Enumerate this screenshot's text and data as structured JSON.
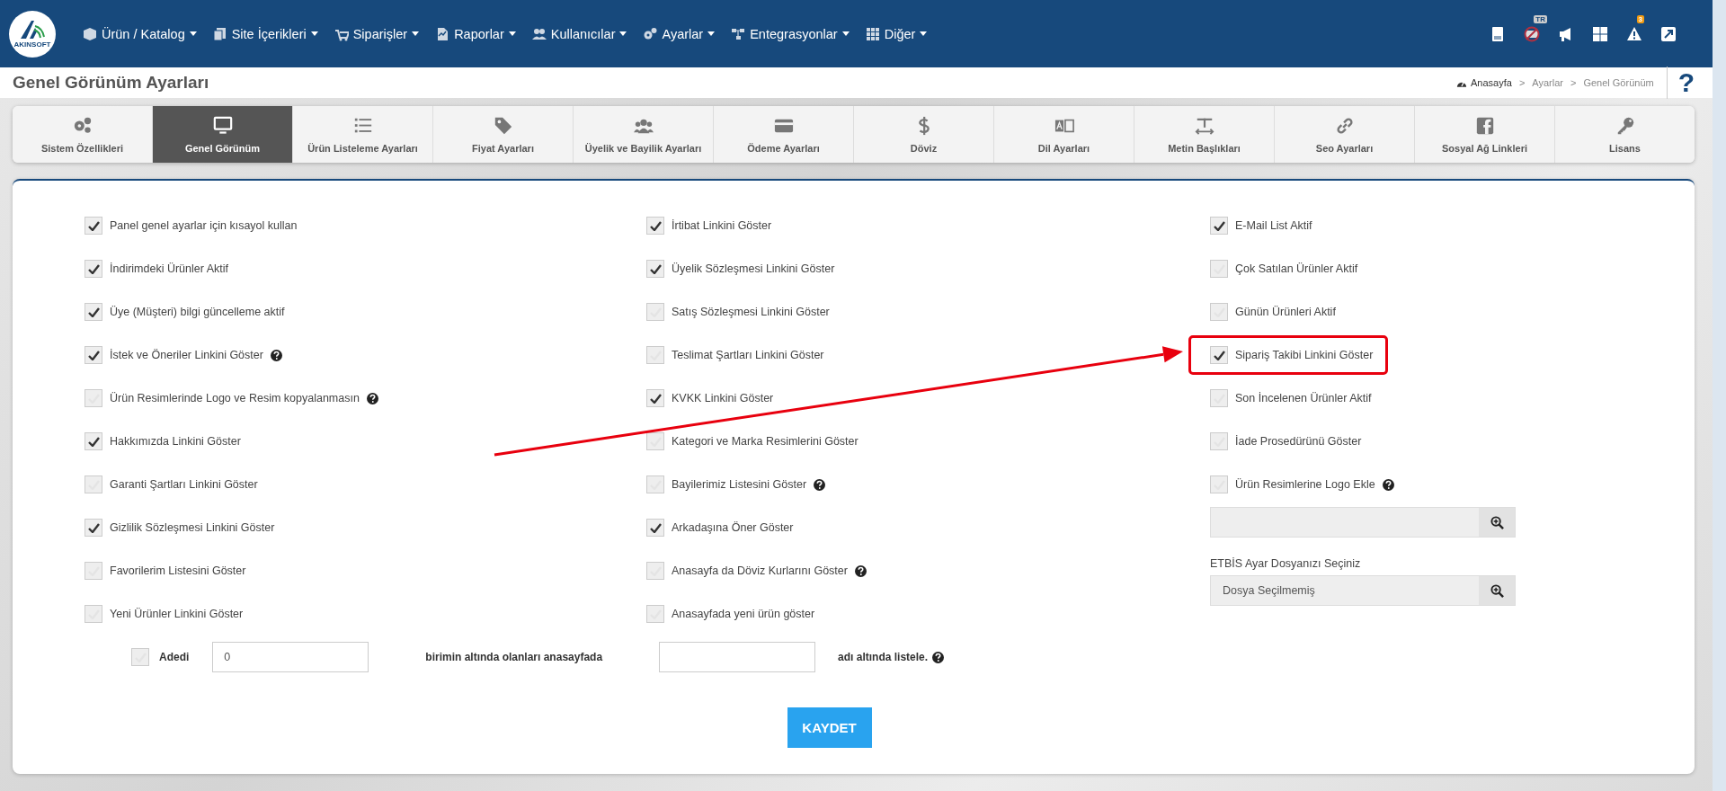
{
  "header": {
    "logo_text": "AKINSOFT",
    "nav": [
      {
        "label": "Ürün / Katalog"
      },
      {
        "label": "Site İçerikleri"
      },
      {
        "label": "Siparişler"
      },
      {
        "label": "Raporlar"
      },
      {
        "label": "Kullanıcılar"
      },
      {
        "label": "Ayarlar"
      },
      {
        "label": "Entegrasyonlar"
      },
      {
        "label": "Diğer"
      }
    ],
    "tools": {
      "language_badge": "TR",
      "alert_count": "3"
    }
  },
  "page_title": "Genel Görünüm Ayarları",
  "breadcrumb": {
    "separator": ">",
    "items": [
      "Anasayfa",
      "Ayarlar",
      "Genel Görünüm"
    ],
    "help": "?"
  },
  "tabs": [
    {
      "label": "Sistem Özellikleri",
      "selected": false
    },
    {
      "label": "Genel Görünüm",
      "selected": true
    },
    {
      "label": "Ürün Listeleme Ayarları",
      "selected": false
    },
    {
      "label": "Fiyat Ayarları",
      "selected": false
    },
    {
      "label": "Üyelik ve Bayilik Ayarları",
      "selected": false
    },
    {
      "label": "Ödeme Ayarları",
      "selected": false
    },
    {
      "label": "Döviz",
      "selected": false
    },
    {
      "label": "Dil Ayarları",
      "selected": false
    },
    {
      "label": "Metin Başlıkları",
      "selected": false
    },
    {
      "label": "Seo Ayarları",
      "selected": false
    },
    {
      "label": "Sosyal Ağ Linkleri",
      "selected": false
    },
    {
      "label": "Lisans",
      "selected": false
    }
  ],
  "columns": [
    {
      "items": [
        {
          "label": "Panel genel ayarlar için kısayol kullan",
          "checked": true,
          "help": false,
          "highlighted": false
        },
        {
          "label": "İndirimdeki Ürünler Aktif",
          "checked": true,
          "help": false,
          "highlighted": false
        },
        {
          "label": "Üye (Müşteri) bilgi güncelleme aktif",
          "checked": true,
          "help": false,
          "highlighted": false
        },
        {
          "label": "İstek ve Öneriler Linkini Göster",
          "checked": true,
          "help": true,
          "highlighted": false
        },
        {
          "label": "Ürün Resimlerinde Logo ve Resim kopyalanmasın",
          "checked": false,
          "help": true,
          "highlighted": false
        },
        {
          "label": "Hakkımızda Linkini Göster",
          "checked": true,
          "help": false,
          "highlighted": false
        },
        {
          "label": "Garanti Şartları Linkini Göster",
          "checked": false,
          "help": false,
          "highlighted": false
        },
        {
          "label": "Gizlilik Sözleşmesi Linkini Göster",
          "checked": true,
          "help": false,
          "highlighted": false
        },
        {
          "label": "Favorilerim Listesini Göster",
          "checked": false,
          "help": false,
          "highlighted": false
        },
        {
          "label": "Yeni Ürünler Linkini Göster",
          "checked": false,
          "help": false,
          "highlighted": false
        }
      ]
    },
    {
      "items": [
        {
          "label": "İrtibat Linkini Göster",
          "checked": true,
          "help": false,
          "highlighted": false
        },
        {
          "label": "Üyelik Sözleşmesi Linkini Göster",
          "checked": true,
          "help": false,
          "highlighted": false
        },
        {
          "label": "Satış Sözleşmesi Linkini Göster",
          "checked": false,
          "help": false,
          "highlighted": false
        },
        {
          "label": "Teslimat Şartları Linkini Göster",
          "checked": false,
          "help": false,
          "highlighted": false
        },
        {
          "label": "KVKK Linkini Göster",
          "checked": true,
          "help": false,
          "highlighted": false
        },
        {
          "label": "Kategori ve Marka Resimlerini Göster",
          "checked": false,
          "help": false,
          "highlighted": false
        },
        {
          "label": "Bayilerimiz Listesini Göster",
          "checked": false,
          "help": true,
          "highlighted": false
        },
        {
          "label": "Arkadaşına Öner Göster",
          "checked": true,
          "help": false,
          "highlighted": false
        },
        {
          "label": "Anasayfa da Döviz Kurlarını Göster",
          "checked": false,
          "help": true,
          "highlighted": false
        },
        {
          "label": "Anasayfada yeni ürün göster",
          "checked": false,
          "help": false,
          "highlighted": false
        }
      ]
    },
    {
      "items": [
        {
          "label": "E-Mail List Aktif",
          "checked": true,
          "help": false,
          "highlighted": false
        },
        {
          "label": "Çok Satılan Ürünler Aktif",
          "checked": false,
          "help": false,
          "highlighted": false
        },
        {
          "label": "Günün Ürünleri Aktif",
          "checked": false,
          "help": false,
          "highlighted": false
        },
        {
          "label": "Sipariş Takibi Linkini Göster",
          "checked": true,
          "help": false,
          "highlighted": true
        },
        {
          "label": "Son İncelenen Ürünler Aktif",
          "checked": false,
          "help": false,
          "highlighted": false
        },
        {
          "label": "İade Prosedürünü Göster",
          "checked": false,
          "help": false,
          "highlighted": false
        },
        {
          "label": "Ürün Resimlerine Logo Ekle",
          "checked": false,
          "help": true,
          "highlighted": false
        }
      ],
      "files": [
        {
          "kind": "plain"
        },
        {
          "kind": "labeled",
          "label": "ETBİS Ayar Dosyanızı Seçiniz",
          "value": "Dosya Seçilmemiş"
        }
      ]
    }
  ],
  "bottom": {
    "checked": false,
    "label": "Adedi",
    "count": "0",
    "middle_text": "birimin altında olanları anasayfada",
    "end_text": "adı altında listele.",
    "help": true
  },
  "save_button": "KAYDET"
}
